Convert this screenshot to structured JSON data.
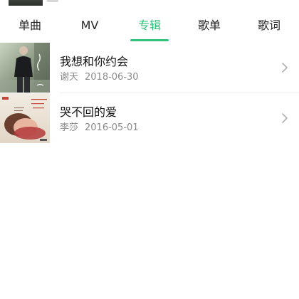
{
  "tabs": [
    {
      "label": "单曲",
      "active": false
    },
    {
      "label": "MV",
      "active": false
    },
    {
      "label": "专辑",
      "active": true
    },
    {
      "label": "歌单",
      "active": false
    },
    {
      "label": "歌词",
      "active": false
    }
  ],
  "albums": [
    {
      "title": "我想和你约会",
      "artist": "谢天",
      "date": "2018-06-30"
    },
    {
      "title": "哭不回的爱",
      "artist": "李莎",
      "date": "2016-05-01"
    }
  ],
  "colors": {
    "accent": "#31c27c",
    "text": "#111111",
    "meta": "#8a8a8a",
    "chevron": "#b0b0b0"
  },
  "icons": {
    "row_action": "chevron-right-icon"
  }
}
